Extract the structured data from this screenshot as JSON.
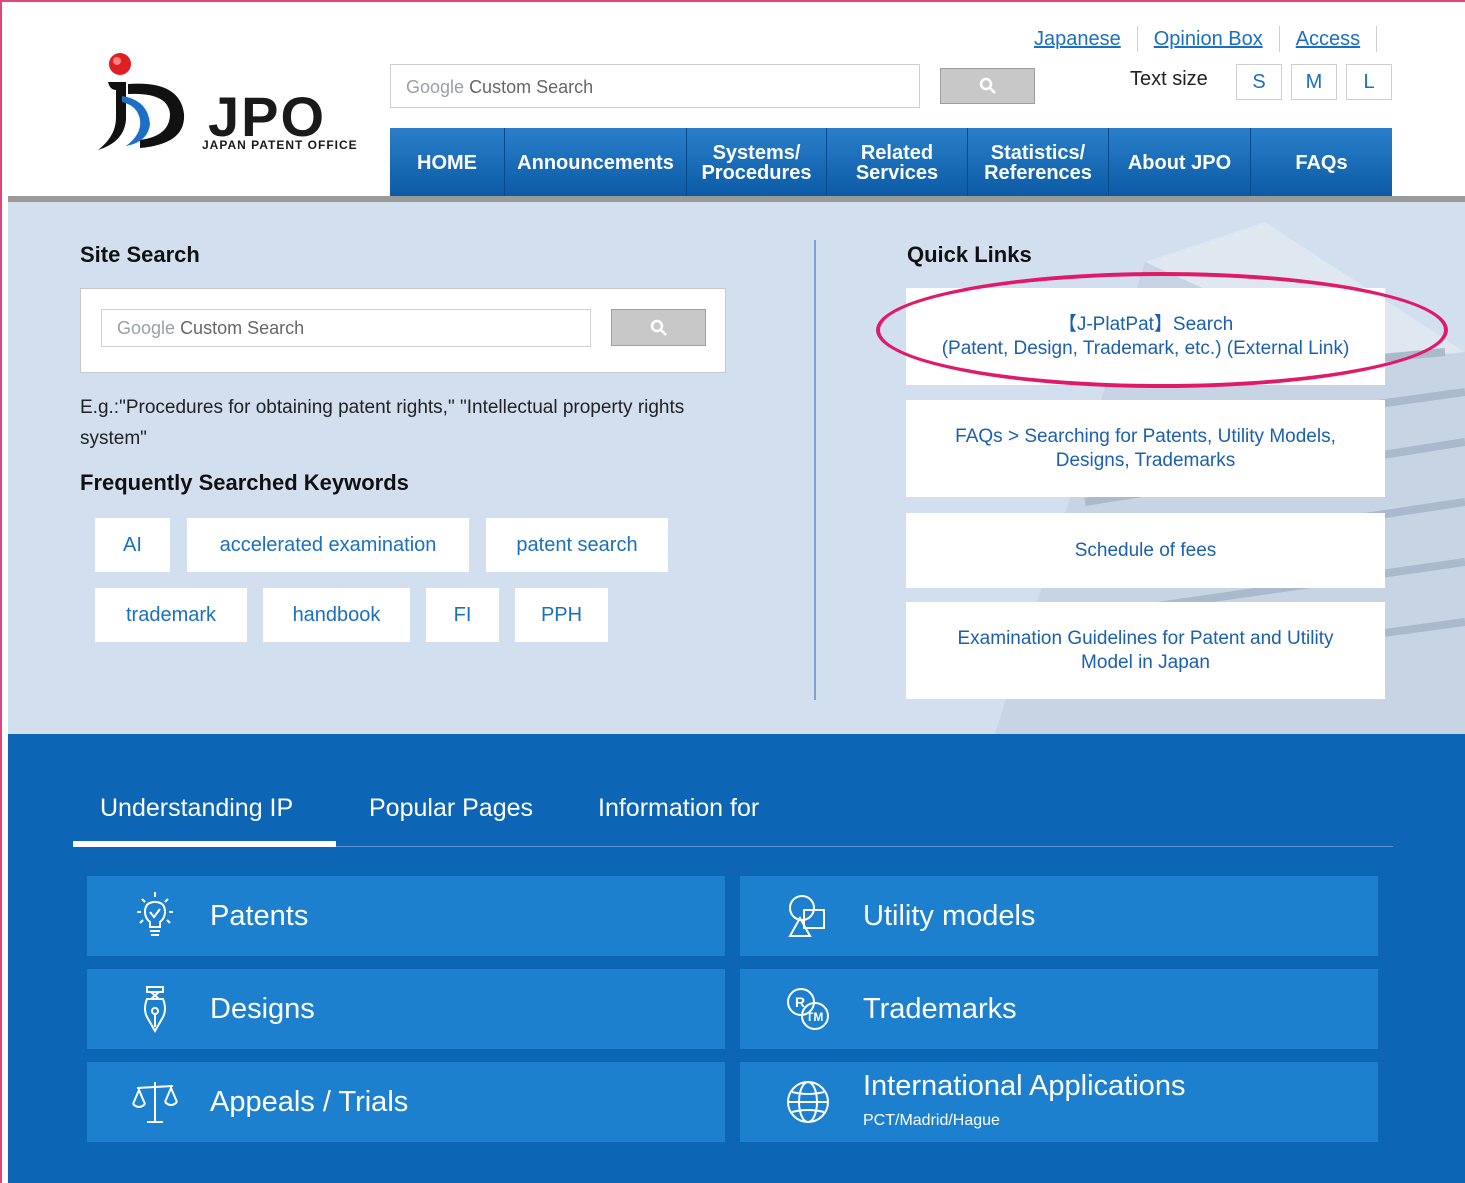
{
  "header": {
    "logo_text": "JPO",
    "logo_subtitle": "JAPAN PATENT OFFICE",
    "search": {
      "google_prefix": "Google",
      "placeholder": "Custom Search"
    },
    "util_links": [
      "Japanese",
      "Opinion Box",
      "Access"
    ],
    "text_size_label": "Text size",
    "text_sizes": [
      "S",
      "M",
      "L"
    ],
    "nav": [
      "HOME",
      "Announcements",
      "Systems/\nProcedures",
      "Related\nServices",
      "Statistics/\nReferences",
      "About JPO",
      "FAQs"
    ]
  },
  "site_search": {
    "title": "Site Search",
    "google_prefix": "Google",
    "placeholder": "Custom Search",
    "example": "E.g.:\"Procedures for obtaining patent rights,\" \"Intellectual property rights system\""
  },
  "keywords": {
    "title": "Frequently Searched Keywords",
    "items": [
      "AI",
      "accelerated examination",
      "patent search",
      "trademark",
      "handbook",
      "FI",
      "PPH"
    ]
  },
  "quick_links": {
    "title": "Quick Links",
    "items": [
      "【J-PlatPat】Search\n(Patent, Design, Trademark, etc.) (External Link)",
      "FAQs > Searching for Patents, Utility Models,\nDesigns, Trademarks",
      "Schedule of fees",
      "Examination Guidelines for Patent and Utility\nModel in Japan"
    ]
  },
  "tabs": [
    "Understanding IP",
    "Popular Pages",
    "Information for"
  ],
  "cards": [
    {
      "label": "Patents",
      "icon": "lightbulb-icon"
    },
    {
      "label": "Utility models",
      "icon": "utility-model-icon"
    },
    {
      "label": "Designs",
      "icon": "pen-nib-icon"
    },
    {
      "label": "Trademarks",
      "icon": "trademark-icon"
    },
    {
      "label": "Appeals / Trials",
      "icon": "scales-icon"
    },
    {
      "label": "International Applications",
      "sub": "PCT/Madrid/Hague",
      "icon": "globe-icon"
    }
  ],
  "colors": {
    "nav_blue": "#0b5aa6",
    "bottom_blue": "#0d66b5",
    "card_blue": "#1d80cf",
    "link_blue": "#1a6fc0",
    "highlight": "#e0196a"
  }
}
